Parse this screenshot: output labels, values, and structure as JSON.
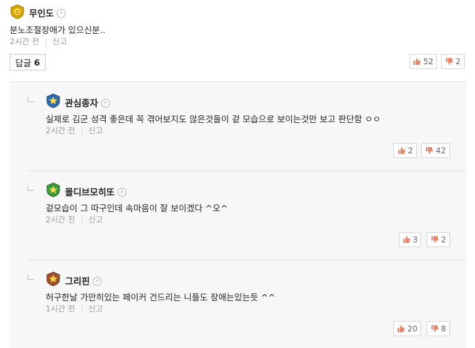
{
  "comment": {
    "nickname": "무인도",
    "text": "분노조절장애가 있으신분..",
    "time": "2시간 전",
    "report": "신고",
    "reply_label": "답글",
    "reply_count": "6",
    "like_count": "52",
    "dislike_count": "2"
  },
  "replies": [
    {
      "nickname": "관심종자",
      "text": "실제로 김군 성격 좋은데 꼭 겪어보지도 않은것들이 겉 모습으로 보이는것만 보고 판단함 ㅇㅇ",
      "time": "2시간 전",
      "report": "신고",
      "like_count": "2",
      "dislike_count": "42"
    },
    {
      "nickname": "몰디브모히또",
      "text": "겉모습이 그 따구인데 속마음이 잘 보이겠다 ^오^",
      "time": "2시간 전",
      "report": "신고",
      "like_count": "3",
      "dislike_count": "2"
    },
    {
      "nickname": "그리핀",
      "text": "허구한날 가만히있는 페이커 건드리는 니들도 장애는있는듯 ^^",
      "time": "1시간 전",
      "report": "신고",
      "like_count": "20",
      "dislike_count": "8"
    }
  ],
  "colors": {
    "badge_gold": "#d9a400",
    "badge_blue": "#2b6cb0",
    "badge_green": "#3a9a3a",
    "badge_bronze": "#a0522d",
    "thumb_up": "#e8866a",
    "thumb_down": "#e8866a"
  }
}
